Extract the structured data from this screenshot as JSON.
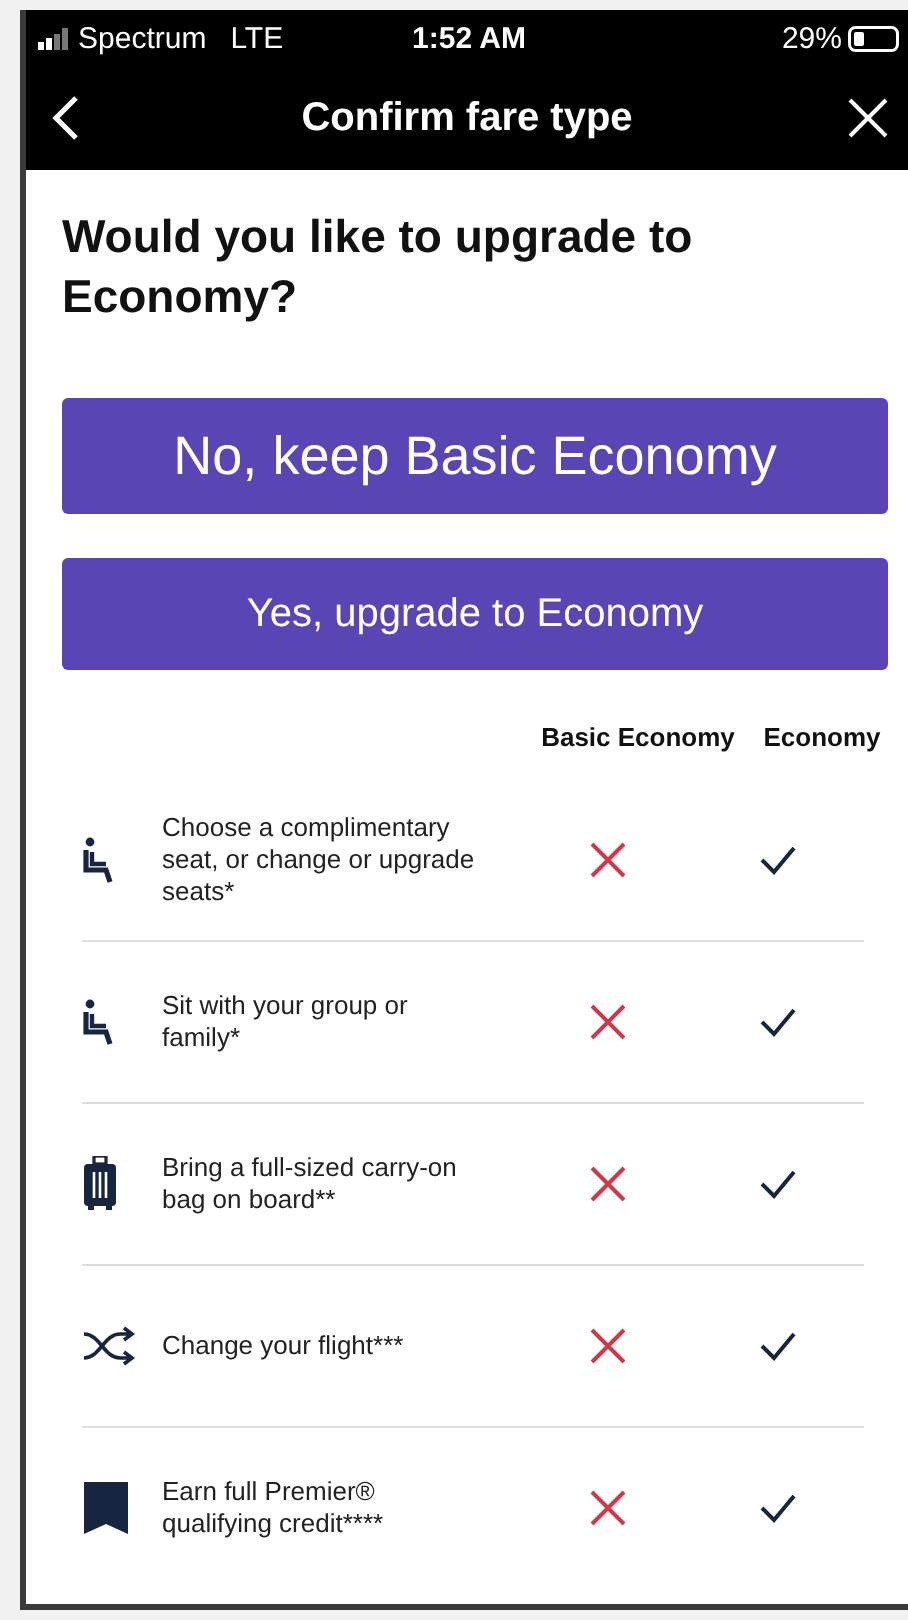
{
  "status_bar": {
    "carrier": "Spectrum",
    "network": "LTE",
    "time": "1:52 AM",
    "battery": "29%"
  },
  "nav": {
    "title": "Confirm fare type"
  },
  "heading": "Would you like to upgrade to Economy?",
  "buttons": [
    {
      "label": "No, keep Basic Economy",
      "kind": "primary"
    },
    {
      "label": "Yes, upgrade to Economy",
      "kind": "secondary"
    }
  ],
  "columns": [
    "Basic Economy",
    "Economy"
  ],
  "features": [
    {
      "kind": "seat",
      "text": "Choose a complimentary seat, or change or upgrade seats*",
      "basic": false,
      "economy": true
    },
    {
      "kind": "seat",
      "text": "Sit with your group or family*",
      "basic": false,
      "economy": true
    },
    {
      "kind": "bag",
      "text": "Bring a full-sized carry-on bag on board**",
      "basic": false,
      "economy": true
    },
    {
      "kind": "shuffle",
      "text": "Change your flight***",
      "basic": false,
      "economy": true
    },
    {
      "kind": "bookmark",
      "text": "Earn full Premier® qualifying credit****",
      "basic": false,
      "economy": true
    }
  ]
}
